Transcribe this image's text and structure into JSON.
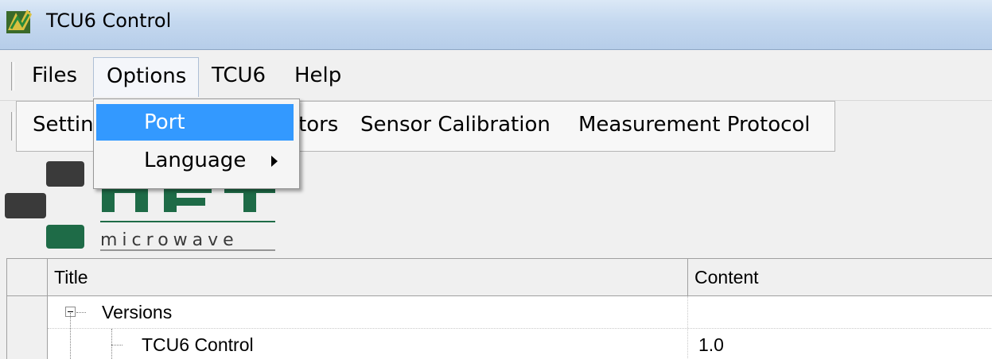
{
  "window": {
    "title": "TCU6 Control"
  },
  "menubar": {
    "items": [
      {
        "label": "Files"
      },
      {
        "label": "Options"
      },
      {
        "label": "TCU6"
      },
      {
        "label": "Help"
      }
    ]
  },
  "tabstrip": {
    "items": [
      {
        "label": "Settin"
      },
      {
        "label": "tors"
      },
      {
        "label": "Sensor Calibration"
      },
      {
        "label": "Measurement Protocol"
      }
    ]
  },
  "dropdown": {
    "items": [
      {
        "label": "Port",
        "highlighted": true
      },
      {
        "label": "Language",
        "has_submenu": true
      }
    ]
  },
  "logo": {
    "text": "microwave",
    "partial_text": "AFT"
  },
  "grid": {
    "columns": [
      {
        "label": "Title"
      },
      {
        "label": "Content"
      }
    ],
    "rows": [
      {
        "title": "Versions",
        "content": "",
        "expanded": true
      },
      {
        "title": "TCU6 Control",
        "content": "1.0"
      }
    ]
  },
  "colors": {
    "highlight": "#3399ff",
    "logo_green": "#1e6b47",
    "logo_gray": "#3a3a3a"
  }
}
